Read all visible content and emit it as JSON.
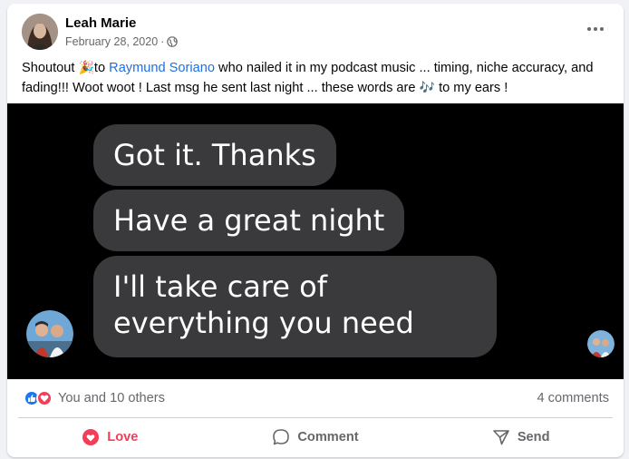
{
  "post": {
    "author": "Leah Marie",
    "date": "February 28, 2020",
    "separator": "·",
    "privacy_icon": "globe-icon",
    "more_icon": "more-options-icon",
    "text_parts": {
      "p1": "Shoutout ",
      "emoji1": "🎉",
      "p2": "to ",
      "mention": "Raymund Soriano",
      "p3": " who nailed it in my podcast music ... timing, niche accuracy, and fading!!! Woot woot ! Last msg he sent last night ... these words are ",
      "emoji2": "🎶",
      "p4": " to my ears !"
    }
  },
  "image": {
    "messages": [
      {
        "text": "Got it. Thanks"
      },
      {
        "text": "Have a great night"
      },
      {
        "text": "I'll take care of everything you need"
      }
    ]
  },
  "stats": {
    "reactions_text": "You and 10 others",
    "comments_text": "4 comments"
  },
  "actions": {
    "love": "Love",
    "comment": "Comment",
    "send": "Send"
  },
  "colors": {
    "accent": "#1877f2",
    "love": "#f33e58",
    "mention": "#216fdb",
    "bubble": "#3a3a3c"
  }
}
